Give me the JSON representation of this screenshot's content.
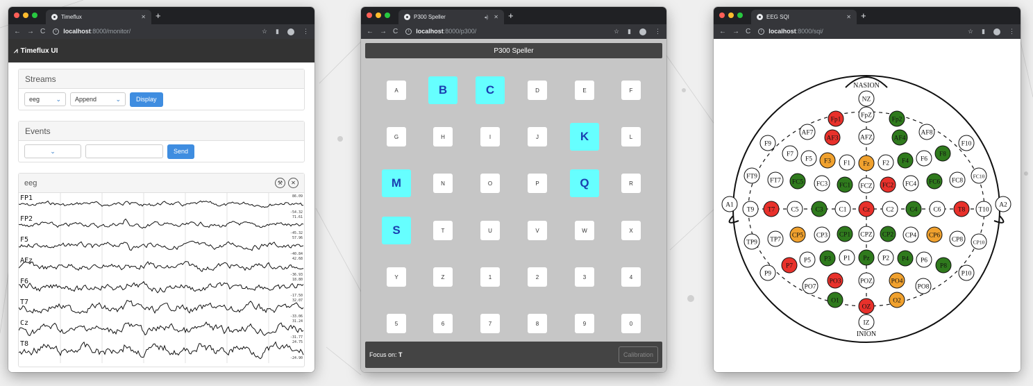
{
  "win1": {
    "tab_title": "Timeflux",
    "url_host": "localhost",
    "url_path": ":8000/monitor/",
    "app_title": "Timeflux UI",
    "streams": {
      "title": "Streams",
      "stream_value": "eeg",
      "mode_value": "Append",
      "display_label": "Display"
    },
    "events": {
      "title": "Events",
      "send_label": "Send"
    },
    "plot": {
      "title": "eeg",
      "channels": [
        {
          "name": "FP1",
          "max": "86.09",
          "min": "-54.32"
        },
        {
          "name": "FP2",
          "max": "71.61",
          "min": "-45.32"
        },
        {
          "name": "F5",
          "max": "57.96",
          "min": "-40.84"
        },
        {
          "name": "AFz",
          "max": "42.68",
          "min": "-36.93"
        },
        {
          "name": "F6",
          "max": "18.80",
          "min": "-17.50"
        },
        {
          "name": "T7",
          "max": "32.07",
          "min": "-33.06"
        },
        {
          "name": "Cz",
          "max": "31.24",
          "min": "-31.77"
        },
        {
          "name": "T8",
          "max": "24.75",
          "min": "-24.90"
        }
      ]
    }
  },
  "win2": {
    "tab_title": "P300 Speller",
    "url_host": "localhost",
    "url_path": ":8000/p300/",
    "header": "P300 Speller",
    "keys": [
      [
        "A",
        "B",
        "C",
        "D",
        "E",
        "F"
      ],
      [
        "G",
        "H",
        "I",
        "J",
        "K",
        "L"
      ],
      [
        "M",
        "N",
        "O",
        "P",
        "Q",
        "R"
      ],
      [
        "S",
        "T",
        "U",
        "V",
        "W",
        "X"
      ],
      [
        "Y",
        "Z",
        "1",
        "2",
        "3",
        "4"
      ],
      [
        "5",
        "6",
        "7",
        "8",
        "9",
        "0"
      ]
    ],
    "highlighted": [
      "B",
      "C",
      "K",
      "M",
      "Q",
      "S"
    ],
    "focus_label": "Focus on: ",
    "focus_value": "T",
    "calibration_label": "Calibration"
  },
  "win3": {
    "tab_title": "EEG SQI",
    "url_host": "localhost",
    "url_path": ":8000/sqi/",
    "nasion": "NASION",
    "inion": "INION",
    "colors": {
      "red": "#e8312b",
      "green": "#2f7a1d",
      "orange": "#f0a12e",
      "white": "#ffffff"
    },
    "electrodes": [
      {
        "label": "NZ",
        "s": "white"
      },
      {
        "label": "FpZ",
        "s": "white"
      },
      {
        "label": "Fp1",
        "s": "red"
      },
      {
        "label": "Fp2",
        "s": "green"
      },
      {
        "label": "AF7",
        "s": "white"
      },
      {
        "label": "AF3",
        "s": "red"
      },
      {
        "label": "AFZ",
        "s": "white"
      },
      {
        "label": "AF4",
        "s": "green"
      },
      {
        "label": "AF8",
        "s": "white"
      },
      {
        "label": "F9",
        "s": "white"
      },
      {
        "label": "F7",
        "s": "white"
      },
      {
        "label": "F5",
        "s": "white"
      },
      {
        "label": "F3",
        "s": "orange"
      },
      {
        "label": "F1",
        "s": "white"
      },
      {
        "label": "Fz",
        "s": "orange"
      },
      {
        "label": "F2",
        "s": "white"
      },
      {
        "label": "F4",
        "s": "green"
      },
      {
        "label": "F6",
        "s": "white"
      },
      {
        "label": "F8",
        "s": "green"
      },
      {
        "label": "F10",
        "s": "white"
      },
      {
        "label": "FT9",
        "s": "white"
      },
      {
        "label": "FT7",
        "s": "white"
      },
      {
        "label": "FC5",
        "s": "green"
      },
      {
        "label": "FC3",
        "s": "white"
      },
      {
        "label": "FC1",
        "s": "green"
      },
      {
        "label": "FCZ",
        "s": "white"
      },
      {
        "label": "FC2",
        "s": "red"
      },
      {
        "label": "FC4",
        "s": "white"
      },
      {
        "label": "FC6",
        "s": "green"
      },
      {
        "label": "FC8",
        "s": "white"
      },
      {
        "label": "FC10",
        "s": "white"
      },
      {
        "label": "A1",
        "s": "white"
      },
      {
        "label": "T9",
        "s": "white"
      },
      {
        "label": "T7",
        "s": "red"
      },
      {
        "label": "C5",
        "s": "white"
      },
      {
        "label": "C3",
        "s": "green"
      },
      {
        "label": "C1",
        "s": "white"
      },
      {
        "label": "Cz",
        "s": "red"
      },
      {
        "label": "C2",
        "s": "white"
      },
      {
        "label": "C4",
        "s": "green"
      },
      {
        "label": "C6",
        "s": "white"
      },
      {
        "label": "T8",
        "s": "red"
      },
      {
        "label": "T10",
        "s": "white"
      },
      {
        "label": "A2",
        "s": "white"
      },
      {
        "label": "TP9",
        "s": "white"
      },
      {
        "label": "TP7",
        "s": "white"
      },
      {
        "label": "CP5",
        "s": "orange"
      },
      {
        "label": "CP3",
        "s": "white"
      },
      {
        "label": "CP1",
        "s": "green"
      },
      {
        "label": "CPZ",
        "s": "white"
      },
      {
        "label": "CP2",
        "s": "green"
      },
      {
        "label": "CP4",
        "s": "white"
      },
      {
        "label": "CP6",
        "s": "orange"
      },
      {
        "label": "CP8",
        "s": "white"
      },
      {
        "label": "CP10",
        "s": "white"
      },
      {
        "label": "P9",
        "s": "white"
      },
      {
        "label": "P7",
        "s": "red"
      },
      {
        "label": "P5",
        "s": "white"
      },
      {
        "label": "P3",
        "s": "green"
      },
      {
        "label": "P1",
        "s": "white"
      },
      {
        "label": "Pz",
        "s": "green"
      },
      {
        "label": "P2",
        "s": "white"
      },
      {
        "label": "P4",
        "s": "green"
      },
      {
        "label": "P6",
        "s": "white"
      },
      {
        "label": "P8",
        "s": "green"
      },
      {
        "label": "P10",
        "s": "white"
      },
      {
        "label": "PO7",
        "s": "white"
      },
      {
        "label": "PO3",
        "s": "red"
      },
      {
        "label": "POZ",
        "s": "white"
      },
      {
        "label": "PO4",
        "s": "orange"
      },
      {
        "label": "PO8",
        "s": "white"
      },
      {
        "label": "O1",
        "s": "green"
      },
      {
        "label": "OZ",
        "s": "red"
      },
      {
        "label": "O2",
        "s": "orange"
      },
      {
        "label": "IZ",
        "s": "white"
      }
    ]
  }
}
